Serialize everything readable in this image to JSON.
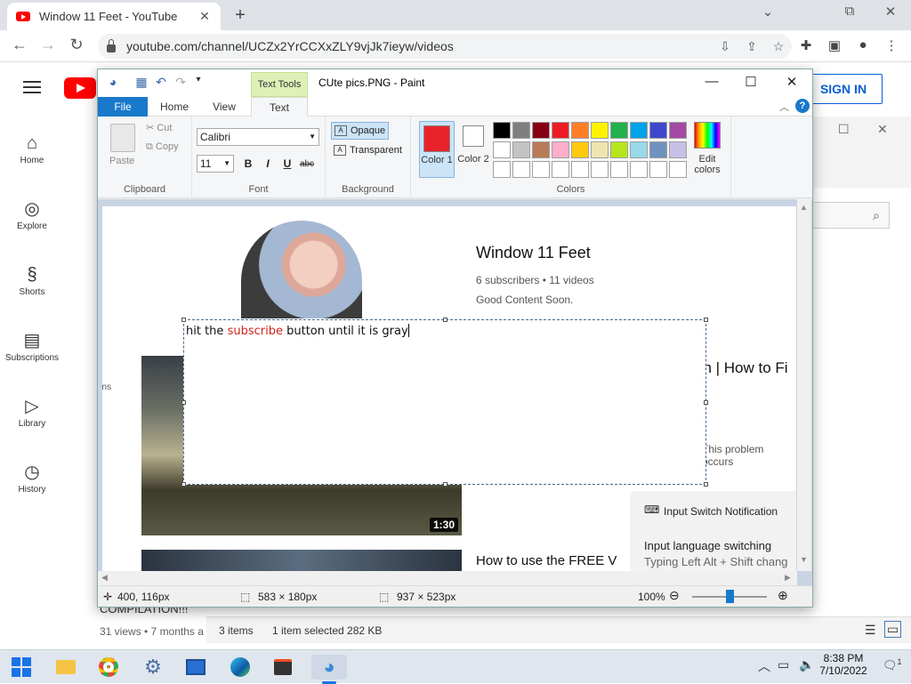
{
  "browser": {
    "tab_title": "Window 11 Feet - YouTube",
    "tab_close": "✕",
    "new_tab": "+",
    "url": "youtube.com/channel/UCZx2YrCCXxZLY9vjJk7ieyw/videos",
    "win_min": "⌄",
    "win_restore": "⧉",
    "win_close": "✕"
  },
  "youtube": {
    "signin_label": "SIGN IN",
    "nav": [
      {
        "label": "Home"
      },
      {
        "label": "Explore"
      },
      {
        "label": "Shorts"
      },
      {
        "label": "Subscriptions"
      },
      {
        "label": "Library"
      },
      {
        "label": "History"
      }
    ],
    "left_fragment": "ons",
    "below_title": "COMPILATION!!!",
    "below_meta": "31 views • 7 months a"
  },
  "explorer_status": {
    "items": "3 items",
    "selected": "1 item selected  282 KB"
  },
  "paint": {
    "title": "CUte pics.PNG - Paint",
    "context_tab": "Text Tools",
    "tabs": [
      "File",
      "Home",
      "View",
      "Text"
    ],
    "clipboard": {
      "paste": "Paste",
      "cut": "Cut",
      "copy": "Copy",
      "label": "Clipboard"
    },
    "font": {
      "family": "Calibri",
      "size": "11",
      "bold": "B",
      "italic": "I",
      "underline": "U",
      "strike": "abc",
      "label": "Font"
    },
    "background": {
      "opaque": "Opaque",
      "transparent": "Transparent",
      "label": "Background"
    },
    "colors": {
      "color1_label": "Color 1",
      "color2_label": "Color 2",
      "edit_label": "Edit colors",
      "label": "Colors",
      "color1": "#e8232a",
      "color2": "#ffffff",
      "palette_row1": [
        "#000000",
        "#7f7f7f",
        "#880015",
        "#ed1c24",
        "#ff7f27",
        "#fff200",
        "#22b14c",
        "#00a2e8",
        "#3f48cc",
        "#a349a4"
      ],
      "palette_row2": [
        "#ffffff",
        "#c3c3c3",
        "#b97a57",
        "#ffaec9",
        "#ffc90e",
        "#efe4b0",
        "#b5e61d",
        "#99d9ea",
        "#7092be",
        "#c8bfe7"
      ],
      "palette_row3": [
        "#ffffff",
        "#ffffff",
        "#ffffff",
        "#ffffff",
        "#ffffff",
        "#ffffff",
        "#ffffff",
        "#ffffff",
        "#ffffff",
        "#ffffff"
      ]
    },
    "canvas": {
      "channel_name": "Window 11 Feet",
      "channel_stats": "6 subscribers • 11 videos",
      "channel_desc": "Good Content Soon.",
      "video1_title_fragment": "en | How to Fi",
      "video1_desc_fragment": "This problem occurs",
      "video1_duration": "1:30",
      "video2_title_fragment": "How to use the FREE V",
      "notif_title": "Input Switch Notification",
      "notif_body1": "Input language switching",
      "notif_body2": "Typing Left Alt + Shift chang",
      "text_before": "hit the ",
      "text_red": "subscribe",
      "text_after": " button until it is gray"
    },
    "status": {
      "cursor": "400, 116px",
      "selection": "583 × 180px",
      "image_size": "937 × 523px",
      "zoom": "100%"
    }
  },
  "taskbar": {
    "time": "8:38 PM",
    "date": "7/10/2022",
    "notif_count": "1"
  }
}
